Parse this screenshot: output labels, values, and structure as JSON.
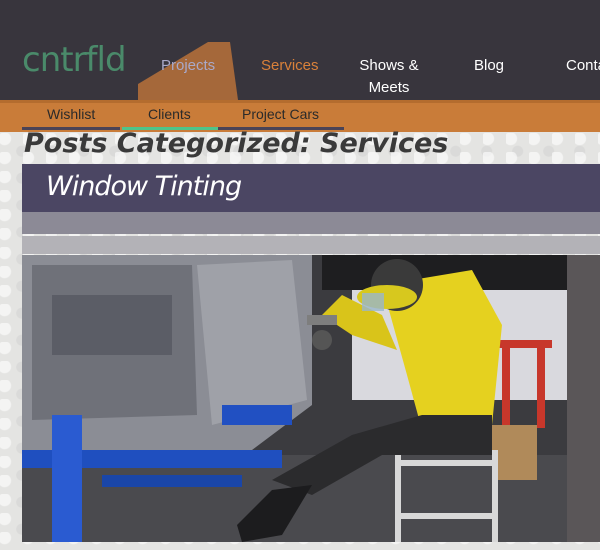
{
  "header": {
    "logo": "cntrfld",
    "nav": [
      {
        "label": "Projects",
        "state": "dim"
      },
      {
        "label": "Services",
        "state": "active"
      },
      {
        "label": "Shows &",
        "label2": "Meets",
        "state": "normal"
      },
      {
        "label": "Blog",
        "state": "normal"
      },
      {
        "label": "Conta",
        "state": "normal"
      }
    ]
  },
  "subnav": {
    "tabs": [
      {
        "label": "Wishlist"
      },
      {
        "label": "Clients",
        "active": true
      },
      {
        "label": "Project Cars"
      }
    ]
  },
  "main": {
    "page_title": "Posts Categorized: Services",
    "post": {
      "title": "Window Tinting"
    }
  },
  "colors": {
    "header_bg": "#38353d",
    "brand_green": "#4a8a6a",
    "accent_orange": "#d9813a",
    "subnav_bg": "#c97c39",
    "active_tab_underline": "#4ec48a",
    "post_header_bg": "#4b4663"
  },
  "icons": {
    "nav_accent": "folder-tab-shape"
  }
}
